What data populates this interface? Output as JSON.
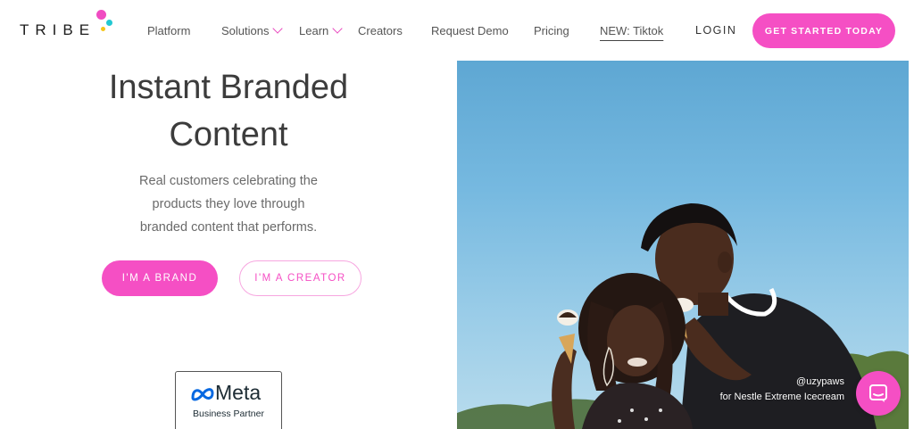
{
  "header": {
    "logo_text": "TRIBE",
    "nav": {
      "platform": "Platform",
      "solutions": "Solutions",
      "learn": "Learn",
      "creators": "Creators",
      "request_demo": "Request Demo",
      "pricing": "Pricing",
      "tiktok": "NEW: Tiktok"
    },
    "login": "LOGIN",
    "cta": "GET STARTED TODAY"
  },
  "hero": {
    "title_line1": "Instant Branded",
    "title_line2": "Content",
    "sub_line1": "Real customers celebrating the",
    "sub_line2": "products they love through",
    "sub_line3": "branded content that performs.",
    "brand_button": "I'M A BRAND",
    "creator_button": "I'M A CREATOR",
    "badge_brand": "Meta",
    "badge_sub": "Business Partner"
  },
  "photo": {
    "credit_handle": "@uzypaws",
    "credit_caption": "for Nestle Extreme Icecream"
  },
  "colors": {
    "accent": "#f54fc4",
    "sky": "#76b9e0"
  },
  "icons": {
    "chevron": "chevron-down-icon",
    "chat": "chat-icon",
    "meta": "meta-infinity-icon"
  }
}
